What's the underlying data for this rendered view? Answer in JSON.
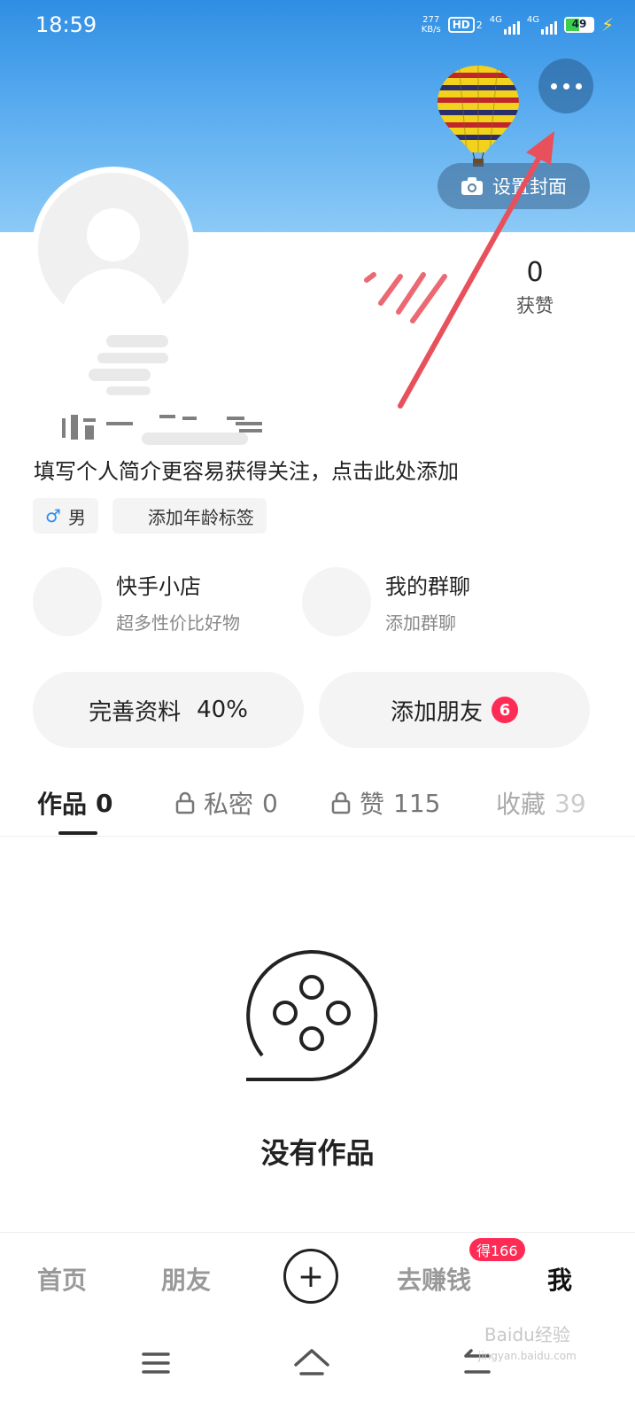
{
  "status": {
    "time": "18:59",
    "speed_value": "277",
    "speed_unit": "KB/s",
    "hd": "HD",
    "hd_sub": "2",
    "net1": "4G",
    "net2": "4G",
    "battery": "49"
  },
  "cover": {
    "set_cover_label": "设置封面"
  },
  "stats": {
    "likes_count": "0",
    "likes_label": "获赞"
  },
  "profile": {
    "bio": "填写个人简介更容易获得关注，点击此处添加",
    "gender_label": "男",
    "age_tag_label": "添加年龄标签",
    "gender_symbol": "♂"
  },
  "quick_links": [
    {
      "title": "快手小店",
      "subtitle": "超多性价比好物"
    },
    {
      "title": "我的群聊",
      "subtitle": "添加群聊"
    }
  ],
  "actions": {
    "complete_profile": "完善资料",
    "complete_percent": "40%",
    "add_friends": "添加朋友",
    "add_friends_badge": "6"
  },
  "tabs": [
    {
      "label": "作品",
      "count": "0"
    },
    {
      "label": "私密",
      "count": "0"
    },
    {
      "label": "赞",
      "count": "115"
    },
    {
      "label": "收藏",
      "count": "39"
    }
  ],
  "empty_state": {
    "text": "没有作品"
  },
  "bottom_nav": {
    "home": "首页",
    "friends": "朋友",
    "earn": "去赚钱",
    "earn_badge": "得166",
    "me": "我",
    "plus": "+"
  },
  "watermark": {
    "brand": "Baidu经验",
    "url": "jingyan.baidu.com"
  },
  "colors": {
    "accent": "#fe2c55",
    "arrow": "#e8505b",
    "male": "#2e8cf0"
  }
}
